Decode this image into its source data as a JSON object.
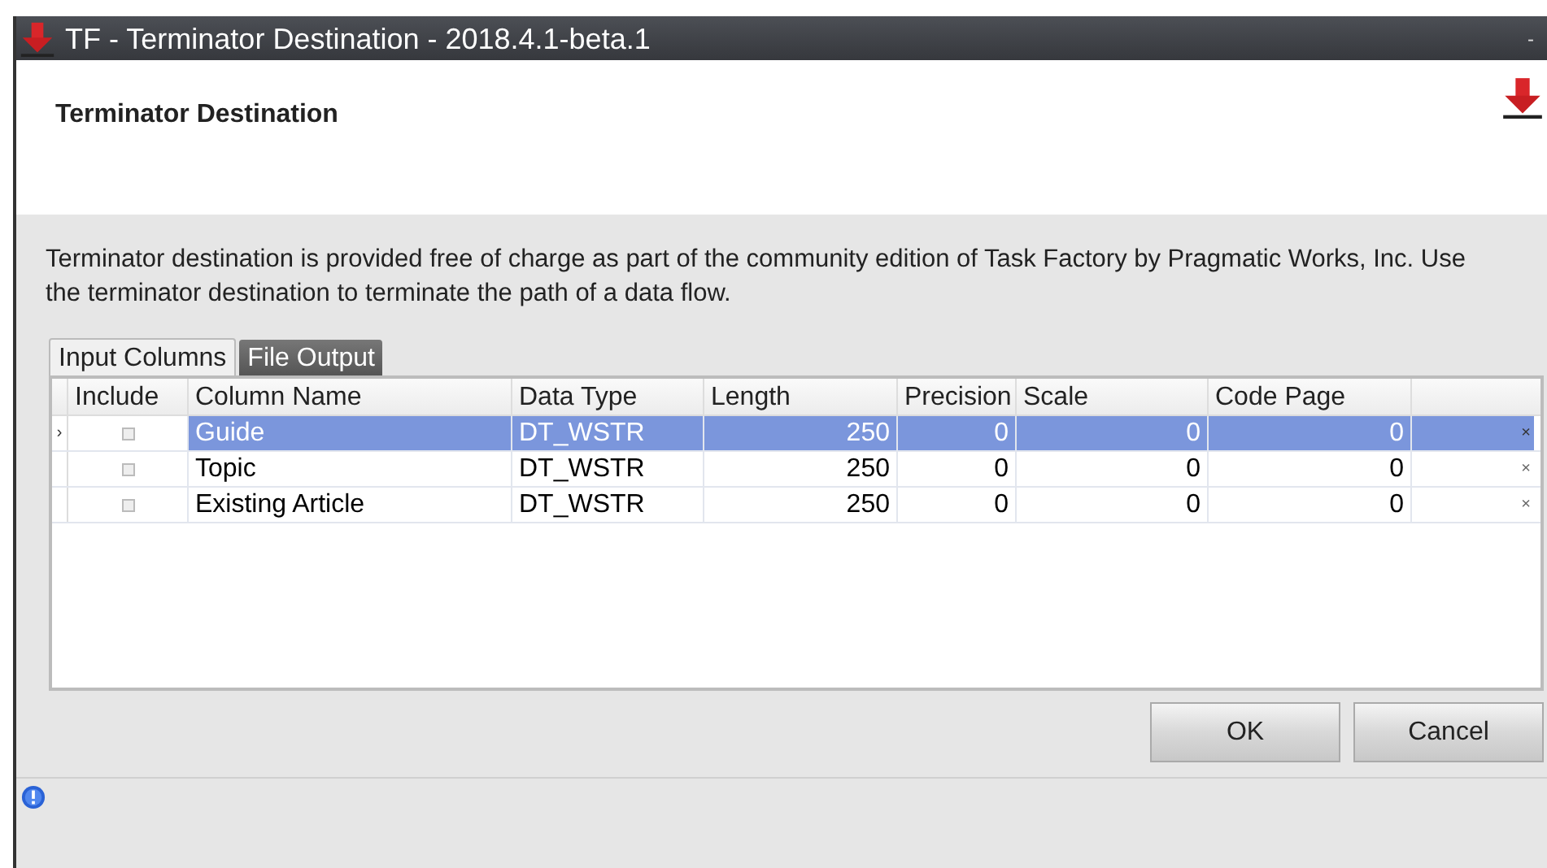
{
  "window": {
    "title": "TF - Terminator Destination - 2018.4.1-beta.1",
    "minimize": "-"
  },
  "header": {
    "title": "Terminator Destination"
  },
  "description": "Terminator destination is provided free of charge as part of the community edition of Task Factory by Pragmatic Works, Inc. Use the terminator destination to terminate the path of a data flow.",
  "tabs": [
    {
      "label": "Input Columns",
      "selected": true
    },
    {
      "label": "File Output",
      "selected": false
    }
  ],
  "table": {
    "columns": [
      "Include",
      "Column Name",
      "Data Type",
      "Length",
      "Precision",
      "Scale",
      "Code Page"
    ],
    "rows": [
      {
        "indicator": "›",
        "selected": true,
        "cells": [
          {
            "kind": "checkbox",
            "checked": false
          },
          {
            "kind": "text",
            "text": "Guide"
          },
          {
            "kind": "text",
            "text": "DT_WSTR"
          },
          {
            "kind": "text",
            "text": "250"
          },
          {
            "kind": "text",
            "text": "0"
          },
          {
            "kind": "text",
            "text": "0"
          },
          {
            "kind": "text",
            "text": "0"
          }
        ],
        "remove": "×"
      },
      {
        "selected": false,
        "cells": [
          {
            "kind": "checkbox",
            "checked": false
          },
          {
            "kind": "text",
            "text": "Topic"
          },
          {
            "kind": "text",
            "text": "DT_WSTR"
          },
          {
            "kind": "text",
            "text": "250"
          },
          {
            "kind": "text",
            "text": "0"
          },
          {
            "kind": "text",
            "text": "0"
          },
          {
            "kind": "text",
            "text": "0"
          }
        ],
        "remove": "×"
      },
      {
        "selected": false,
        "cells": [
          {
            "kind": "checkbox",
            "checked": false
          },
          {
            "kind": "text",
            "text": "Existing Article"
          },
          {
            "kind": "text",
            "text": "DT_WSTR"
          },
          {
            "kind": "text",
            "text": "250"
          },
          {
            "kind": "text",
            "text": "0"
          },
          {
            "kind": "text",
            "text": "0"
          },
          {
            "kind": "text",
            "text": "0"
          }
        ],
        "remove": "×"
      }
    ]
  },
  "buttons": [
    "OK",
    "Cancel"
  ]
}
